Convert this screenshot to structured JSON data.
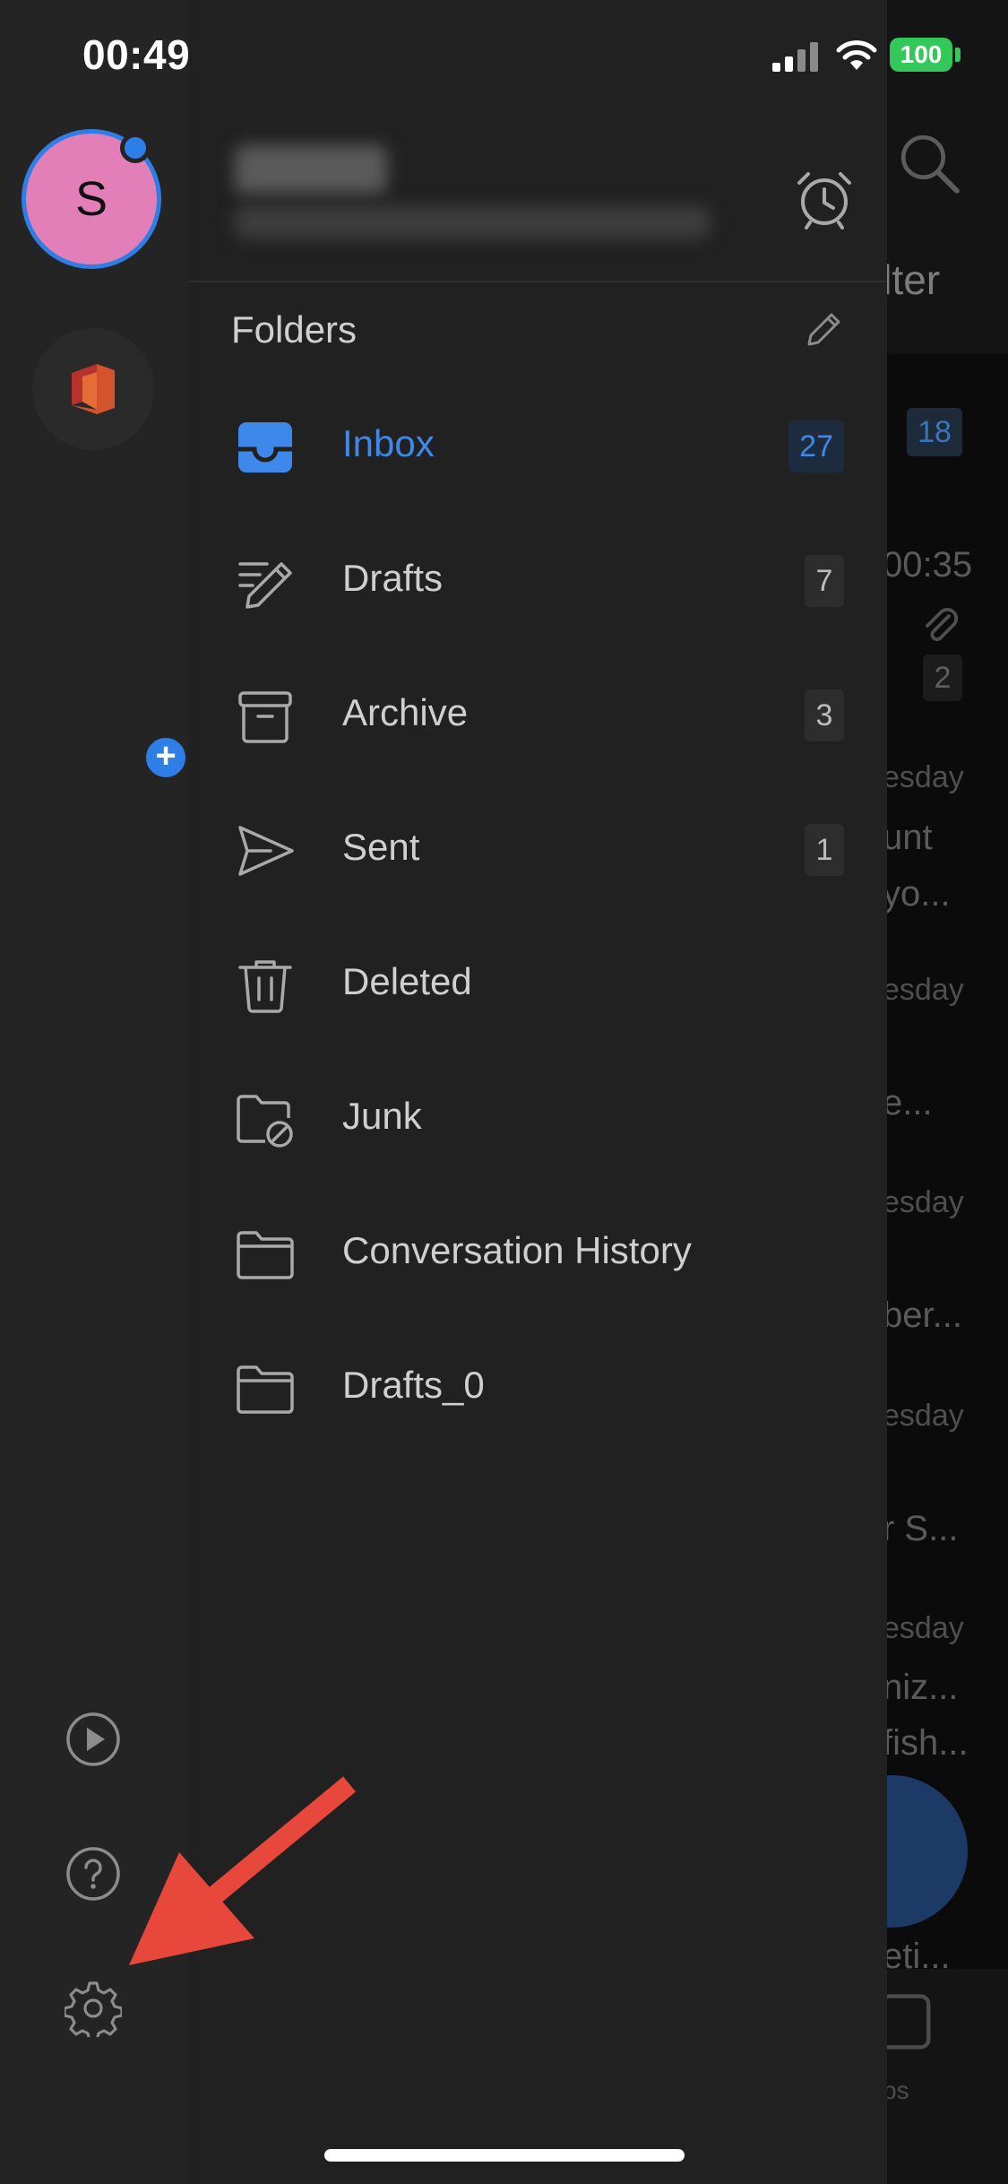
{
  "status_bar": {
    "time": "00:49",
    "battery": "100"
  },
  "account": {
    "avatar_initial": "S"
  },
  "drawer": {
    "section_title": "Folders",
    "folders": [
      {
        "name": "Inbox",
        "count": "27",
        "icon": "inbox-icon",
        "active": true
      },
      {
        "name": "Drafts",
        "count": "7",
        "icon": "drafts-icon"
      },
      {
        "name": "Archive",
        "count": "3",
        "icon": "archive-icon"
      },
      {
        "name": "Sent",
        "count": "1",
        "icon": "sent-icon"
      },
      {
        "name": "Deleted",
        "count": "",
        "icon": "trash-icon"
      },
      {
        "name": "Junk",
        "count": "",
        "icon": "junk-folder-icon"
      },
      {
        "name": "Conversation History",
        "count": "",
        "icon": "folder-icon"
      },
      {
        "name": "Drafts_0",
        "count": "",
        "icon": "folder-icon"
      }
    ]
  },
  "background": {
    "filter_label": "ilter",
    "inbox_count": "18",
    "time": "00:35",
    "attachment_count": "2",
    "snippets": [
      "esday",
      "unt",
      "yo...",
      "esday",
      "e...",
      "esday",
      "ber...",
      "esday",
      "r S...",
      "esday",
      "niz...",
      "fish...",
      "eti..."
    ],
    "apps_label": "ps"
  },
  "colors": {
    "accent": "#3d88ea",
    "annotation_arrow": "#e8473b",
    "avatar_bg": "#e37fb8"
  }
}
